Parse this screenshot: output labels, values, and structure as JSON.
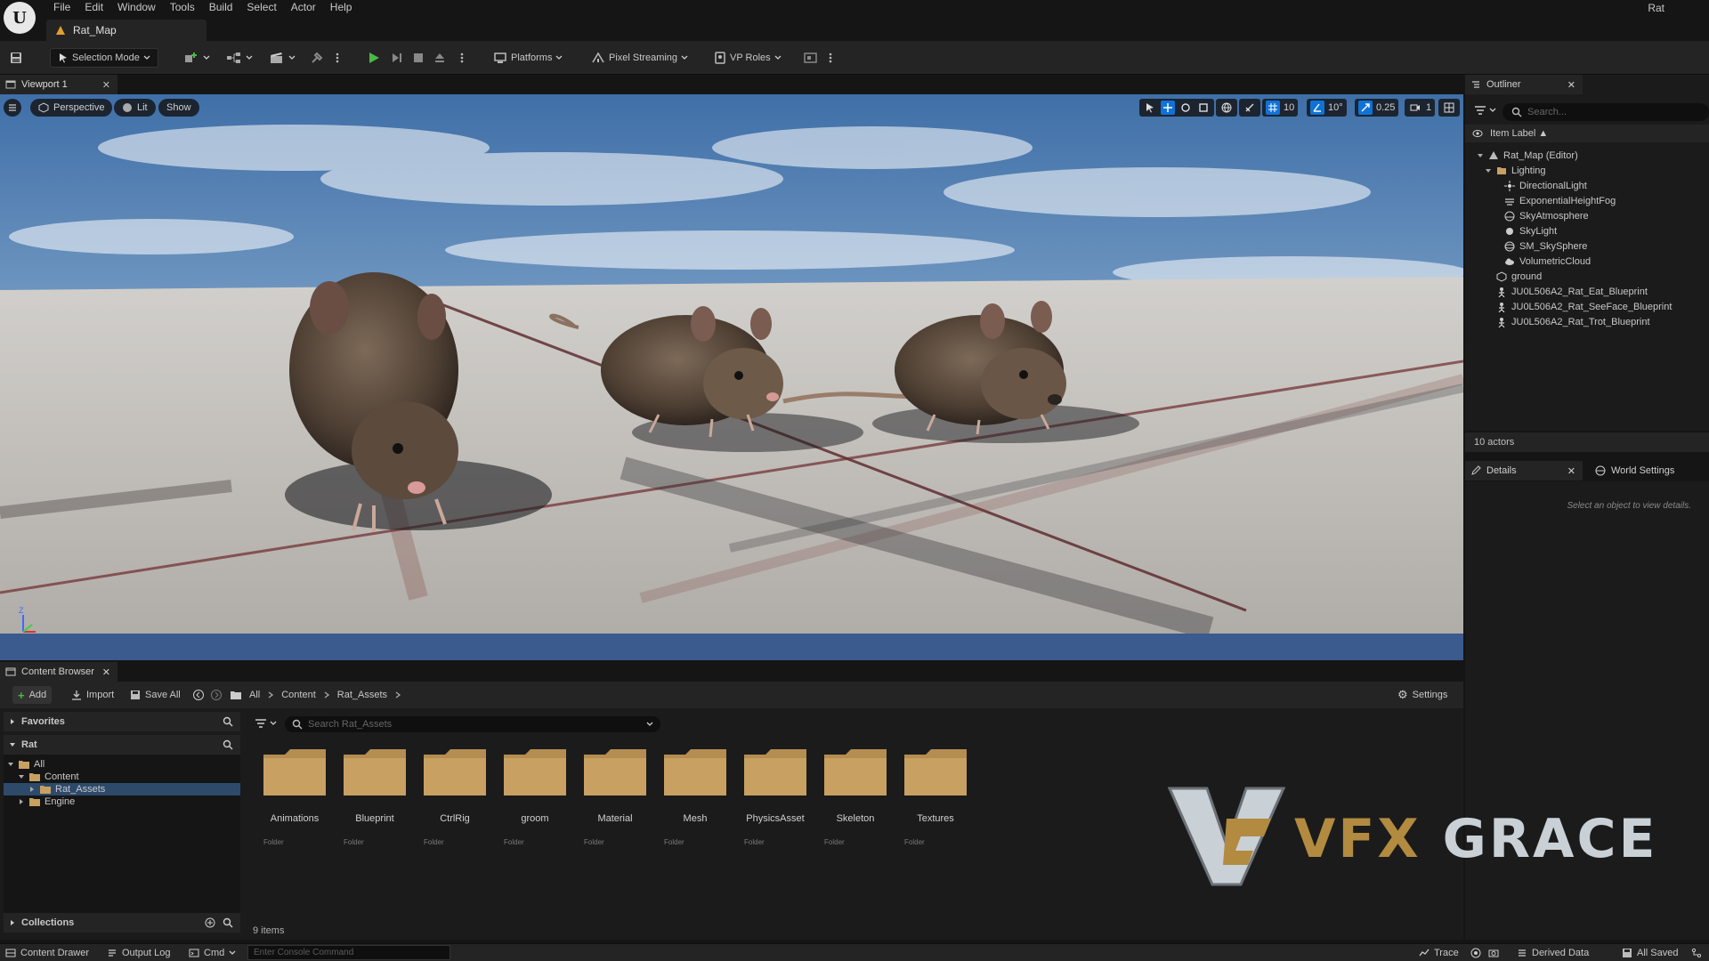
{
  "app": {
    "logo_letter": "U",
    "project_name": "Rat",
    "map_tab": "Rat_Map"
  },
  "menu": [
    "File",
    "Edit",
    "Window",
    "Tools",
    "Build",
    "Select",
    "Actor",
    "Help"
  ],
  "toolbar": {
    "selection_mode": "Selection Mode",
    "platforms": "Platforms",
    "pixel_streaming": "Pixel Streaming",
    "vp_roles": "VP Roles"
  },
  "viewport": {
    "tab_label": "Viewport 1",
    "view_mode": "Perspective",
    "lighting": "Lit",
    "show": "Show",
    "grid_snap": "10",
    "rotation_snap": "10°",
    "scale_snap": "0.25",
    "camera_speed": "1"
  },
  "outliner": {
    "title": "Outliner",
    "search_placeholder": "Search...",
    "column_label": "Item Label ▲",
    "items": [
      {
        "label": "Rat_Map (Editor)",
        "indent": 1,
        "icon": "map-icon",
        "expanded": true
      },
      {
        "label": "Lighting",
        "indent": 2,
        "icon": "folder-icon",
        "expanded": true
      },
      {
        "label": "DirectionalLight",
        "indent": 3,
        "icon": "directional-light-icon"
      },
      {
        "label": "ExponentialHeightFog",
        "indent": 3,
        "icon": "fog-icon"
      },
      {
        "label": "SkyAtmosphere",
        "indent": 3,
        "icon": "sky-atmosphere-icon"
      },
      {
        "label": "SkyLight",
        "indent": 3,
        "icon": "sky-light-icon"
      },
      {
        "label": "SM_SkySphere",
        "indent": 3,
        "icon": "sphere-icon"
      },
      {
        "label": "VolumetricCloud",
        "indent": 3,
        "icon": "cloud-icon"
      },
      {
        "label": "ground",
        "indent": 2,
        "icon": "mesh-icon"
      },
      {
        "label": "JU0L506A2_Rat_Eat_Blueprint",
        "indent": 2,
        "icon": "blueprint-icon"
      },
      {
        "label": "JU0L506A2_Rat_SeeFace_Blueprint",
        "indent": 2,
        "icon": "blueprint-icon"
      },
      {
        "label": "JU0L506A2_Rat_Trot_Blueprint",
        "indent": 2,
        "icon": "blueprint-icon"
      }
    ],
    "actor_count": "10 actors"
  },
  "details": {
    "tab": "Details",
    "world_settings_tab": "World Settings",
    "empty_message": "Select an object to view details."
  },
  "content_browser": {
    "tab": "Content Browser",
    "add": "Add",
    "import": "Import",
    "save_all": "Save All",
    "breadcrumb": [
      "All",
      "Content",
      "Rat_Assets"
    ],
    "settings": "Settings",
    "favorites": "Favorites",
    "project_section": "Rat",
    "collections": "Collections",
    "tree": [
      {
        "label": "All",
        "indent": 0,
        "expanded": true
      },
      {
        "label": "Content",
        "indent": 1,
        "expanded": true
      },
      {
        "label": "Rat_Assets",
        "indent": 2,
        "expanded": false,
        "selected": true
      },
      {
        "label": "Engine",
        "indent": 1,
        "expanded": false
      }
    ],
    "search_placeholder": "Search Rat_Assets",
    "folders": [
      {
        "name": "Animations",
        "type": "Folder"
      },
      {
        "name": "Blueprint",
        "type": "Folder"
      },
      {
        "name": "CtrlRig",
        "type": "Folder"
      },
      {
        "name": "groom",
        "type": "Folder"
      },
      {
        "name": "Material",
        "type": "Folder"
      },
      {
        "name": "Mesh",
        "type": "Folder"
      },
      {
        "name": "PhysicsAsset",
        "type": "Folder"
      },
      {
        "name": "Skeleton",
        "type": "Folder"
      },
      {
        "name": "Textures",
        "type": "Folder"
      }
    ],
    "item_count": "9 items"
  },
  "watermark": {
    "word1": "VFX",
    "word2": "GRACE"
  },
  "statusbar": {
    "content_drawer": "Content Drawer",
    "output_log": "Output Log",
    "cmd": "Cmd",
    "console_placeholder": "Enter Console Command",
    "trace": "Trace",
    "derived_data": "Derived Data",
    "all_saved": "All Saved"
  },
  "colors": {
    "accent_blue": "#0f72d8",
    "play_green": "#4cb848",
    "folder": "#c7a062",
    "panel_bg": "#1b1b1b"
  }
}
